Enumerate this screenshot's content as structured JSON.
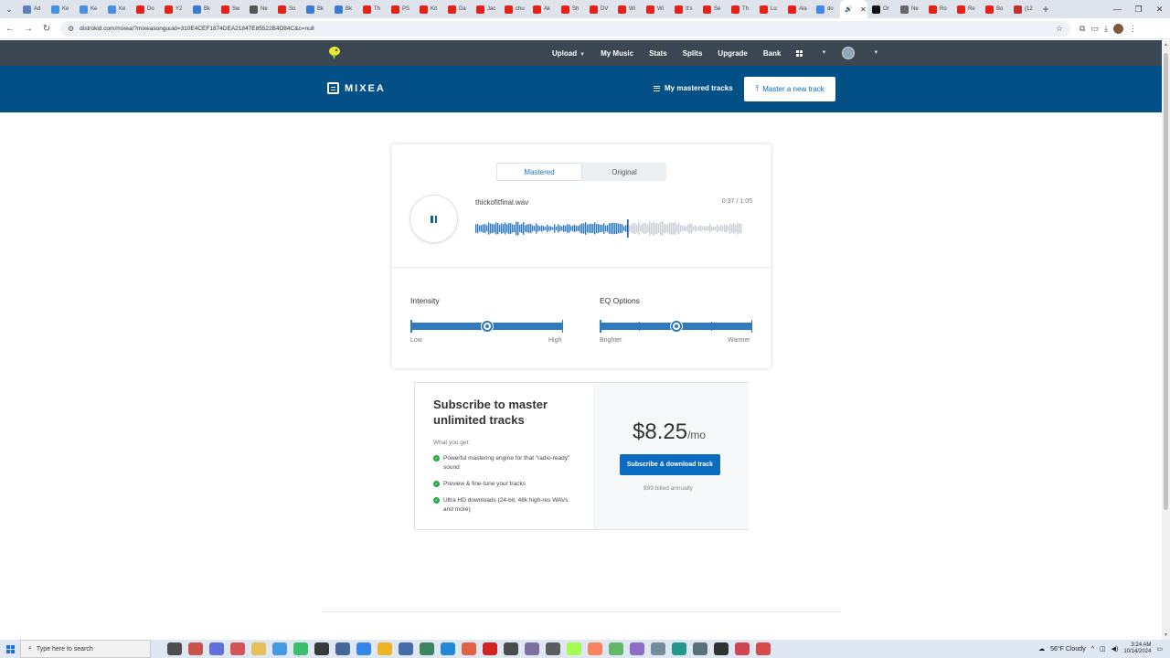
{
  "browser": {
    "tabs": [
      "Ad",
      "Ke",
      "Ke",
      "Ke",
      "Do",
      "Y2",
      "Bk",
      "Sw",
      "Ne",
      "So",
      "Bk",
      "Bk",
      "Th",
      "PS",
      "Kit",
      "Da",
      "Jac",
      "chu",
      "Ak",
      "Sh",
      "DV",
      "Wi",
      "Wi",
      "It's",
      "Se",
      "Th",
      "Lu",
      "Ala",
      "do",
      "",
      "Or",
      "Ne",
      "Ro",
      "Re",
      "Bo",
      "(12"
    ],
    "url": "distrokid.com/mixea/?mixeasonguuid=310E4CEF1874DEA21847E85522B4D84C&c=null"
  },
  "distrokid_nav": {
    "upload": "Upload",
    "my_music": "My Music",
    "stats": "Stats",
    "splits": "Splits",
    "upgrade": "Upgrade",
    "bank": "Bank"
  },
  "mixea_header": {
    "brand": "MIXEA",
    "my_tracks": "My mastered tracks",
    "master_new": "Master a new track"
  },
  "player": {
    "tabs": [
      "Mastered",
      "Original"
    ],
    "active_tab": "Mastered",
    "file_name": "thickofitfinal.wav",
    "time": "0:37 / 1:05",
    "progress": 0.569,
    "intensity": {
      "title": "Intensity",
      "low": "Low",
      "high": "High",
      "value": 0.5
    },
    "eq": {
      "title": "EQ Options",
      "left": "Brighter",
      "right": "Warmer",
      "value": 0.5,
      "steps": 5
    }
  },
  "subscribe": {
    "title": "Subscribe to master unlimited tracks",
    "what_you_get": "What you get:",
    "features": [
      "Powerful mastering engine for that \"radio-ready\" sound",
      "Preview & fine-tune your tracks",
      "Ultra HD downloads (24-bit, 48k high-res WAVs and more)"
    ],
    "price": "$8.25",
    "per": "/mo",
    "button": "Subscribe & download track",
    "billed": "$99 billed annually"
  },
  "taskbar": {
    "search_placeholder": "Type here to search",
    "weather": "56°F  Cloudy",
    "time": "3:24 AM",
    "date": "10/14/2024"
  },
  "colors": {
    "dk_bar": "#3a4752",
    "mixea_blue": "#025085",
    "accent": "#2f7ac0",
    "wave_unplayed": "#c9ced4"
  }
}
